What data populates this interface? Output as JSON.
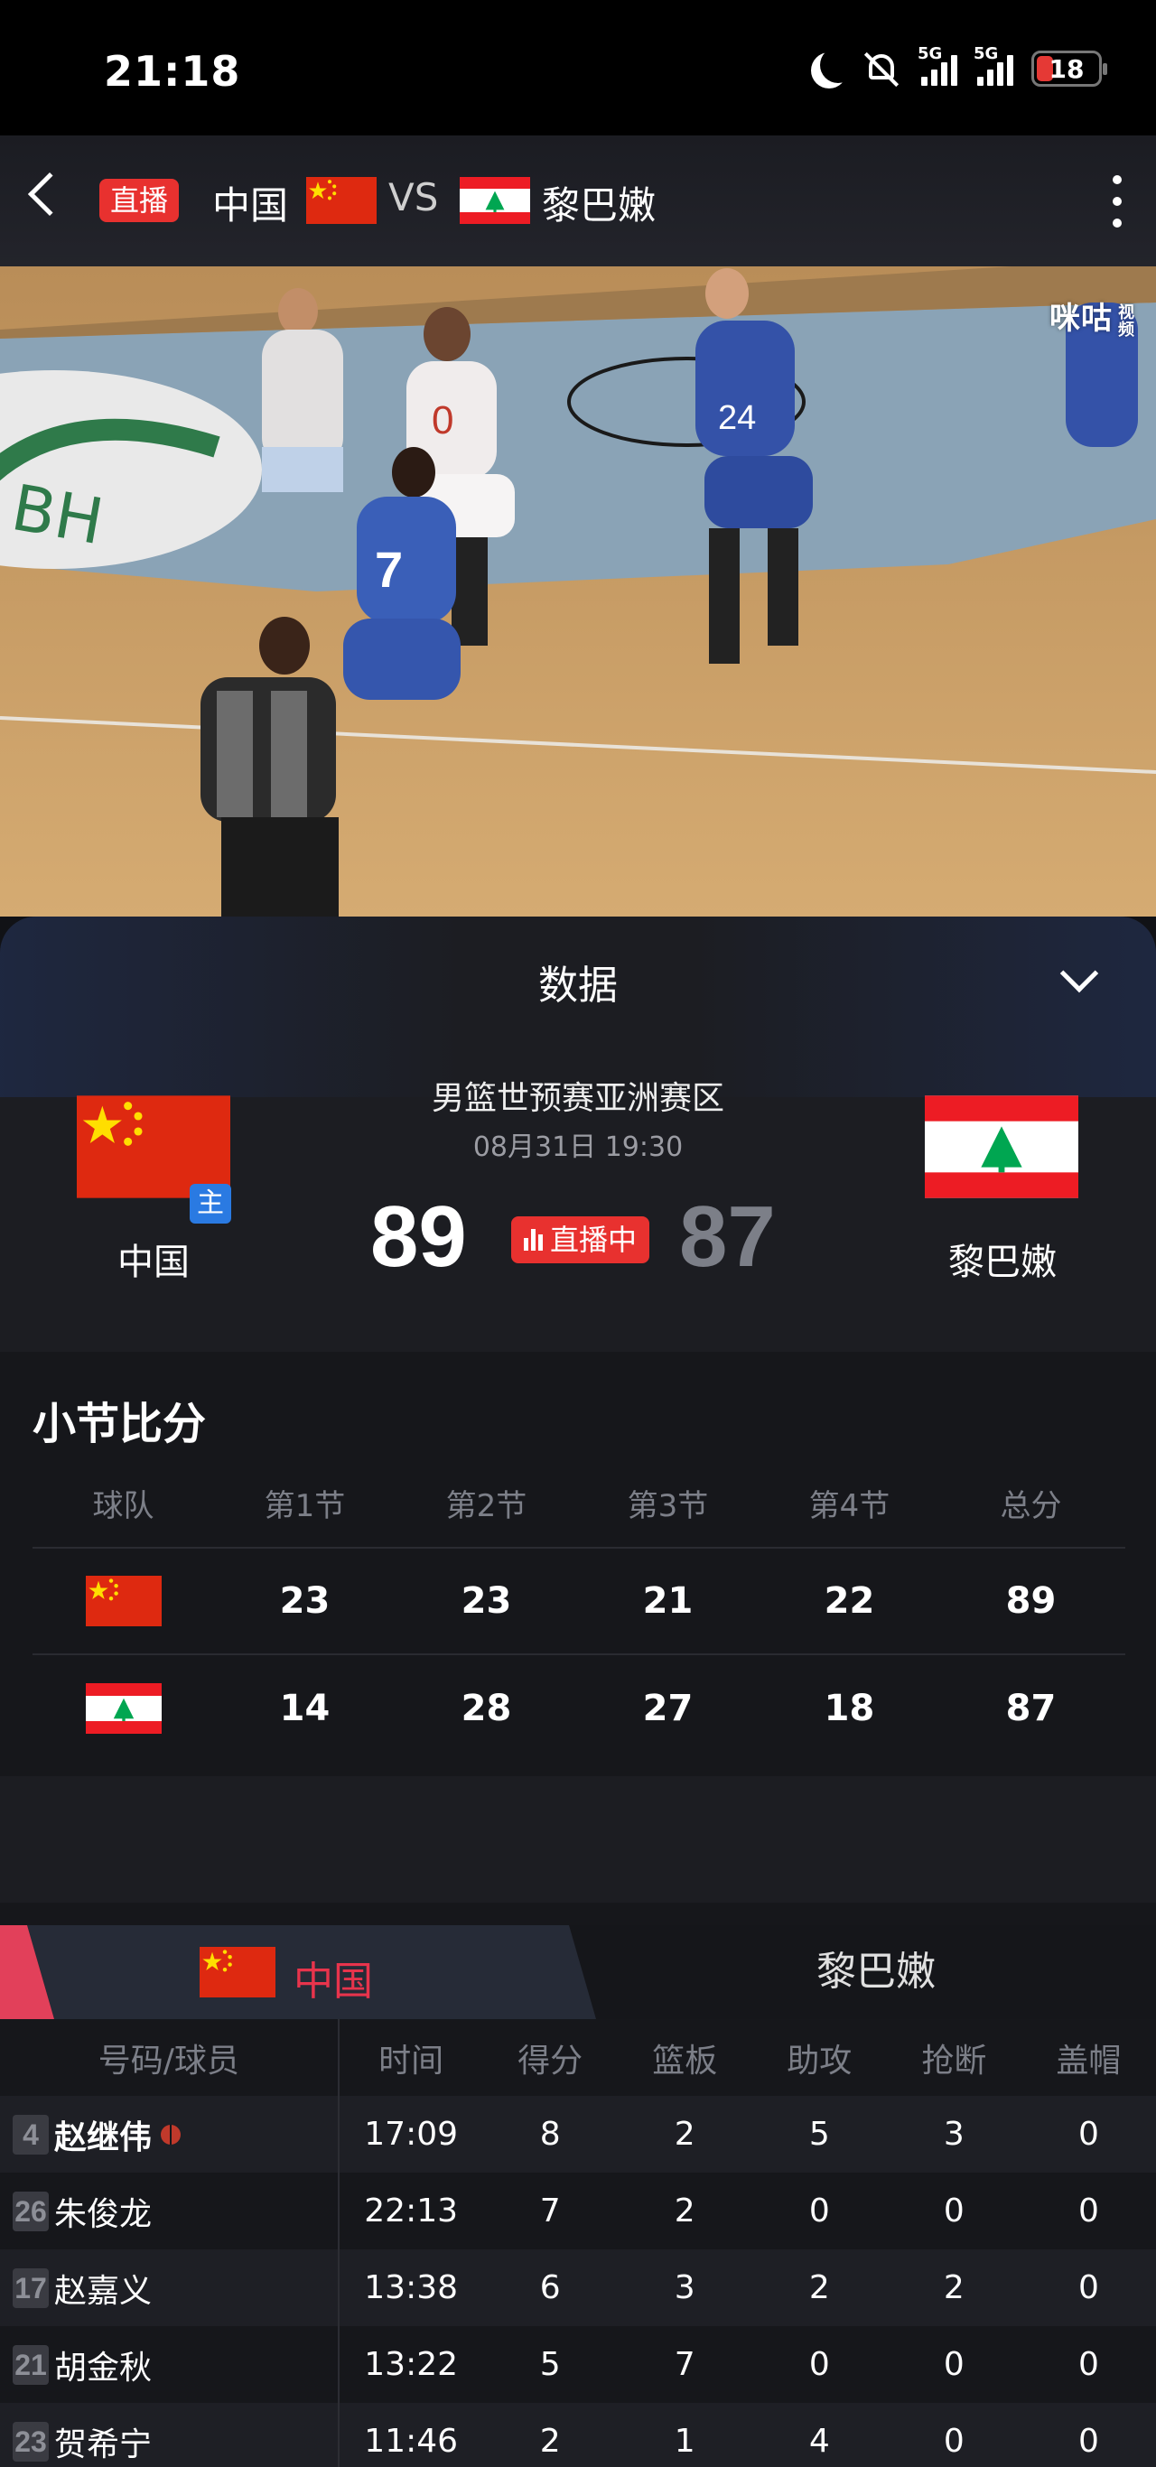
{
  "status": {
    "time": "21:18",
    "battery": "18",
    "net1": "5G",
    "net2": "5G"
  },
  "header": {
    "live_badge": "直播",
    "home": "中国",
    "vs": "VS",
    "away": "黎巴嫩"
  },
  "video": {
    "watermark": "咪咕",
    "watermark_sub": "视频"
  },
  "panel": {
    "title": "数据",
    "league": "男篮世预赛亚洲赛区",
    "datetime": "08月31日 19:30",
    "home_name": "中国",
    "home_tag": "主",
    "away_name": "黎巴嫩",
    "home_score": "89",
    "away_score": "87",
    "live_status": "直播中"
  },
  "quarters": {
    "title": "小节比分",
    "headers": [
      "球队",
      "第1节",
      "第2节",
      "第3节",
      "第4节",
      "总分"
    ],
    "rows": [
      {
        "team": "中国",
        "scores": [
          "23",
          "23",
          "21",
          "22",
          "89"
        ]
      },
      {
        "team": "黎巴嫩",
        "scores": [
          "14",
          "28",
          "27",
          "18",
          "87"
        ]
      }
    ]
  },
  "players_section": {
    "tab_home": "中国",
    "tab_away": "黎巴嫩",
    "headers": [
      "号码/球员",
      "时间",
      "得分",
      "篮板",
      "助攻",
      "抢断",
      "盖帽"
    ],
    "rows": [
      {
        "num": "4",
        "name": "赵继伟",
        "min": "17:09",
        "pts": "8",
        "reb": "2",
        "ast": "5",
        "stl": "3",
        "blk": "0"
      },
      {
        "num": "26",
        "name": "朱俊龙",
        "min": "22:13",
        "pts": "7",
        "reb": "2",
        "ast": "0",
        "stl": "0",
        "blk": "0"
      },
      {
        "num": "17",
        "name": "赵嘉义",
        "min": "13:38",
        "pts": "6",
        "reb": "3",
        "ast": "2",
        "stl": "2",
        "blk": "0"
      },
      {
        "num": "21",
        "name": "胡金秋",
        "min": "13:22",
        "pts": "5",
        "reb": "7",
        "ast": "0",
        "stl": "0",
        "blk": "0"
      },
      {
        "num": "23",
        "name": "贺希宁",
        "min": "11:46",
        "pts": "2",
        "reb": "1",
        "ast": "4",
        "stl": "0",
        "blk": "0"
      }
    ]
  },
  "colors": {
    "accent_red": "#e8312f",
    "tab_pink": "#e2405a",
    "home_tag_blue": "#2a7ae2",
    "panel_bg": "#1c1d22"
  }
}
